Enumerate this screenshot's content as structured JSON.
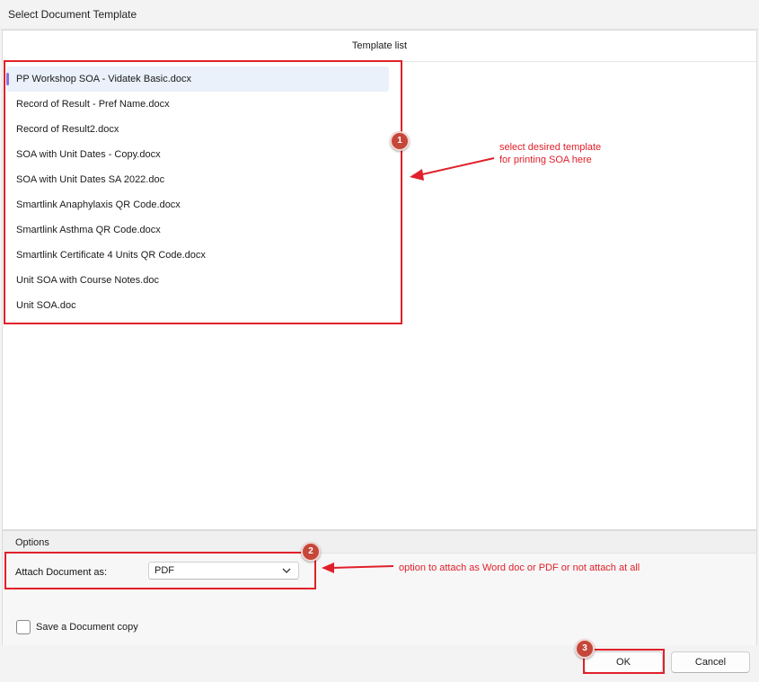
{
  "window": {
    "title": "Select Document Template"
  },
  "template_list": {
    "header": "Template list",
    "items": [
      "PP Workshop SOA - Vidatek Basic.docx",
      "Record of Result - Pref Name.docx",
      "Record of Result2.docx",
      "SOA with Unit Dates - Copy.docx",
      "SOA with Unit Dates SA 2022.doc",
      "Smartlink Anaphylaxis QR Code.docx",
      "Smartlink Asthma QR Code.docx",
      "Smartlink Certificate 4 Units QR Code.docx",
      "Unit SOA with Course Notes.doc",
      "Unit SOA.doc"
    ],
    "selected_index": 0
  },
  "options": {
    "label": "Options",
    "attach_label": "Attach Document as:",
    "attach_value": "PDF",
    "save_copy_label": "Save a Document copy",
    "save_copy_checked": false
  },
  "footer": {
    "ok_label": "OK",
    "cancel_label": "Cancel"
  },
  "annotations": {
    "badge1": "1",
    "badge2": "2",
    "badge3": "3",
    "note1_line1": "select desired template",
    "note1_line2": "for printing SOA here",
    "note2": "option to attach as Word doc or PDF or not attach at all",
    "color": "#e0202a"
  },
  "icons": {
    "dropdown": "chevron-down-icon"
  }
}
